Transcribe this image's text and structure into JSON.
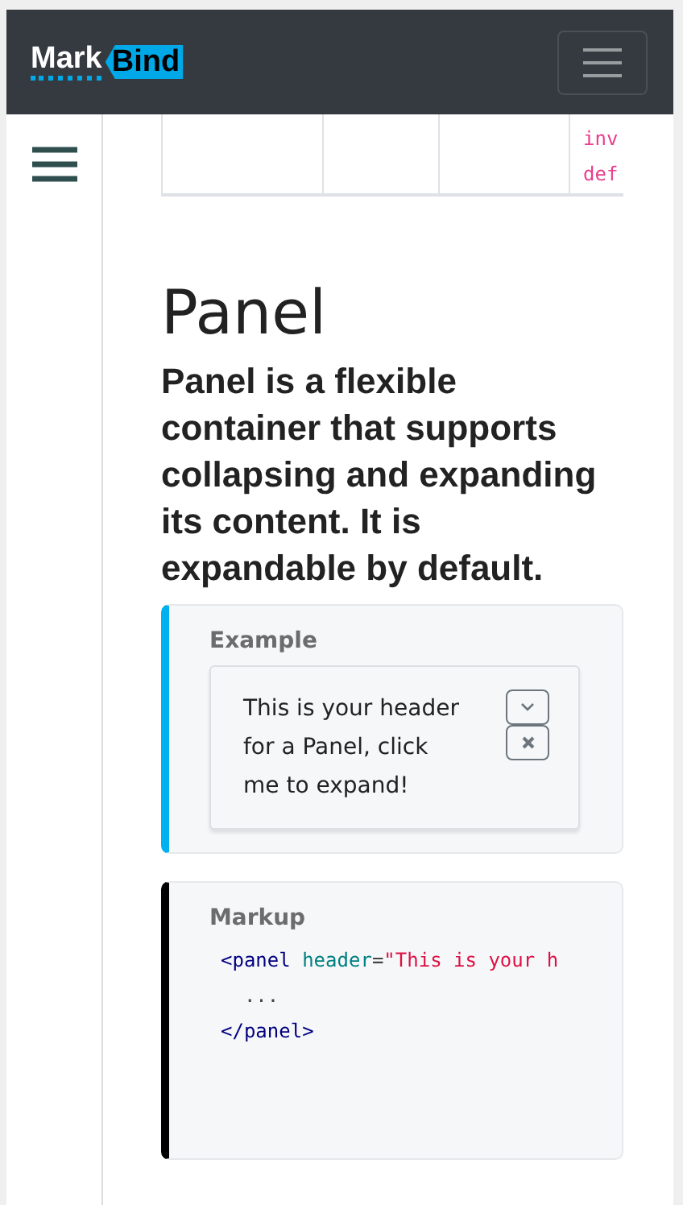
{
  "navbar": {
    "logo": {
      "mark": "Mark",
      "bind": "Bind"
    }
  },
  "table_fragment": {
    "cells": [
      "inv",
      "def"
    ]
  },
  "heading": "Panel",
  "lead": "Panel is a flexible container that supports collapsing and expanding its content. It is expandable by default.",
  "example": {
    "title": "Example",
    "panel": {
      "header": "This is your header for a Panel, click me to expand!",
      "expanded": false
    }
  },
  "markup": {
    "title": "Markup",
    "lines": [
      [
        {
          "kind": "tag",
          "text": "<panel"
        },
        {
          "kind": "attr",
          "text": " header"
        },
        {
          "kind": "plain",
          "text": "="
        },
        {
          "kind": "string",
          "text": "\"This is your h"
        }
      ],
      [
        {
          "kind": "plain",
          "text": "  ..."
        }
      ],
      [
        {
          "kind": "tag",
          "text": "</panel>"
        }
      ]
    ]
  }
}
